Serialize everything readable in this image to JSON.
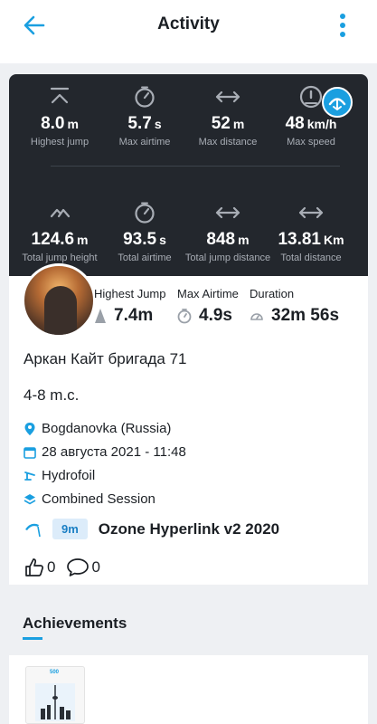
{
  "header": {
    "title": "Activity",
    "back_icon": "arrow-left-icon",
    "menu_icon": "more-vertical-icon",
    "accent": "#1a9fe0"
  },
  "stats": {
    "row1": [
      {
        "value": "8.0",
        "unit": "m",
        "label": "Highest jump",
        "icon": "jump-up-icon"
      },
      {
        "value": "5.7",
        "unit": "s",
        "label": "Max airtime",
        "icon": "stopwatch-icon"
      },
      {
        "value": "52",
        "unit": "m",
        "label": "Max distance",
        "icon": "double-arrow-icon"
      },
      {
        "value": "48",
        "unit": "km/h",
        "label": "Max speed",
        "icon": "speedometer-icon"
      }
    ],
    "row2": [
      {
        "value": "124.6",
        "unit": "m",
        "label": "Total jump height",
        "icon": "jump-up-double-icon"
      },
      {
        "value": "93.5",
        "unit": "s",
        "label": "Total airtime",
        "icon": "stopwatch-icon"
      },
      {
        "value": "848",
        "unit": "m",
        "label": "Total jump distance",
        "icon": "double-arrow-icon"
      },
      {
        "value": "13.81",
        "unit": "Km",
        "label": "Total distance",
        "icon": "double-arrow-icon"
      }
    ]
  },
  "summary": {
    "highest_jump_label": "Highest Jump",
    "highest_jump_value": "7.4m",
    "max_airtime_label": "Max Airtime",
    "max_airtime_value": "4.9s",
    "duration_label": "Duration",
    "duration_value": "32m 56s"
  },
  "session": {
    "title": "Аркан Кайт бригада 71",
    "wind": "4-8 m.c.",
    "location": "Bogdanovka (Russia)",
    "date": "28 августа 2021 - 11:48",
    "sport": "Hydrofoil",
    "type": "Combined Session",
    "kite_size": "9m",
    "kite_name": "Ozone Hyperlink v2 2020",
    "likes": "0",
    "comments": "0"
  },
  "achievements": {
    "title": "Achievements",
    "card_number": "500"
  }
}
